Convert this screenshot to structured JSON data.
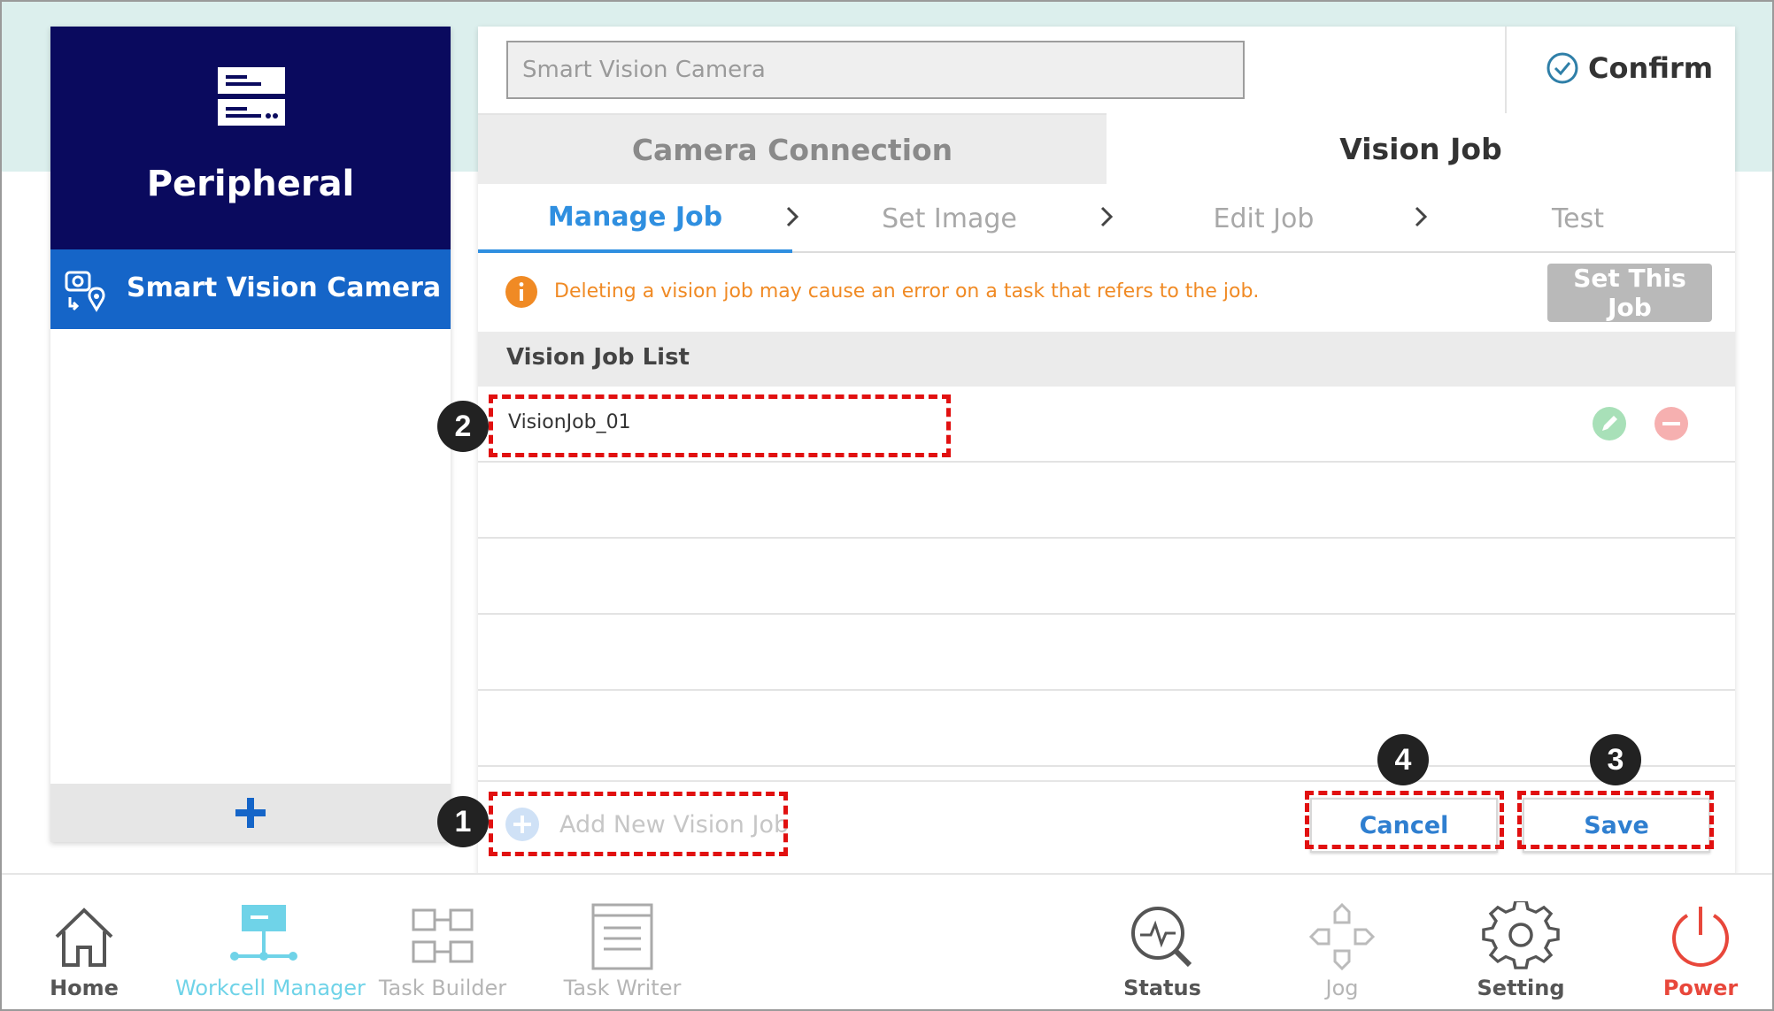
{
  "left_panel": {
    "title": "Peripheral",
    "items": [
      {
        "label": "Smart Vision Camera",
        "icon": "vision-camera-icon"
      }
    ],
    "add_icon": "plus-icon"
  },
  "main": {
    "device_name": "Smart Vision Camera",
    "confirm_label": "Confirm",
    "tabs": [
      {
        "label": "Camera Connection",
        "active": false
      },
      {
        "label": "Vision Job",
        "active": true
      }
    ],
    "steps": [
      {
        "label": "Manage Job",
        "active": true
      },
      {
        "label": "Set Image",
        "active": false
      },
      {
        "label": "Edit Job",
        "active": false
      },
      {
        "label": "Test",
        "active": false
      }
    ],
    "warning": "Deleting a vision job may cause an error on a task that refers to the job.",
    "set_job_label": "Set This Job",
    "list_title": "Vision Job List",
    "jobs": [
      "VisionJob_01"
    ],
    "add_job_label": "Add New Vision Job",
    "cancel_label": "Cancel",
    "save_label": "Save"
  },
  "annotations": [
    "1",
    "2",
    "3",
    "4"
  ],
  "nav": [
    {
      "label": "Home",
      "icon": "home-icon",
      "state": "normal"
    },
    {
      "label": "Workcell Manager",
      "icon": "workcell-icon",
      "state": "active"
    },
    {
      "label": "Task Builder",
      "icon": "task-builder-icon",
      "state": "disabled"
    },
    {
      "label": "Task Writer",
      "icon": "task-writer-icon",
      "state": "disabled"
    },
    {
      "label": "Status",
      "icon": "status-icon",
      "state": "normal"
    },
    {
      "label": "Jog",
      "icon": "jog-icon",
      "state": "disabled"
    },
    {
      "label": "Setting",
      "icon": "gear-icon",
      "state": "normal"
    },
    {
      "label": "Power",
      "icon": "power-icon",
      "state": "alert"
    }
  ],
  "colors": {
    "header_navy": "#0a0a5e",
    "selected_blue": "#1565c8",
    "accent_blue": "#2f8fe0",
    "warning_orange": "#f08a24",
    "edit_green": "#a8e0b8",
    "delete_red": "#f6b0b0",
    "power_red": "#e8473b",
    "workcell_cyan": "#6fd3e8",
    "annotation_red": "#e11010"
  }
}
